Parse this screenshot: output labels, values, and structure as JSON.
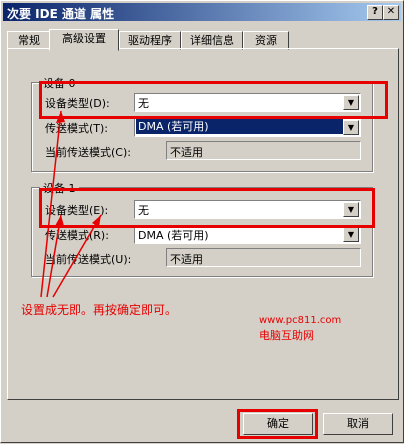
{
  "window": {
    "title": "次要 IDE 通道 属性",
    "help": "?",
    "close": "✕"
  },
  "tabs": [
    {
      "label": "常规"
    },
    {
      "label": "高级设置"
    },
    {
      "label": "驱动程序"
    },
    {
      "label": "详细信息"
    },
    {
      "label": "资源"
    }
  ],
  "device0": {
    "title": "设备 0",
    "type_label": "设备类型(D):",
    "type_value": "无",
    "transfer_label": "传送模式(T):",
    "transfer_value": "DMA (若可用)",
    "current_label": "当前传送模式(C):",
    "current_value": "不适用"
  },
  "device1": {
    "title": "设备 1",
    "type_label": "设备类型(E):",
    "type_value": "无",
    "transfer_label": "传送模式(R):",
    "transfer_value": "DMA (若可用)",
    "current_label": "当前传送模式(U):",
    "current_value": "不适用"
  },
  "annotation": "设置成无即。再按确定即可。",
  "watermark": {
    "url": "www.pc811.com",
    "name": "电脑互助网"
  },
  "buttons": {
    "ok": "确定",
    "cancel": "取消"
  }
}
